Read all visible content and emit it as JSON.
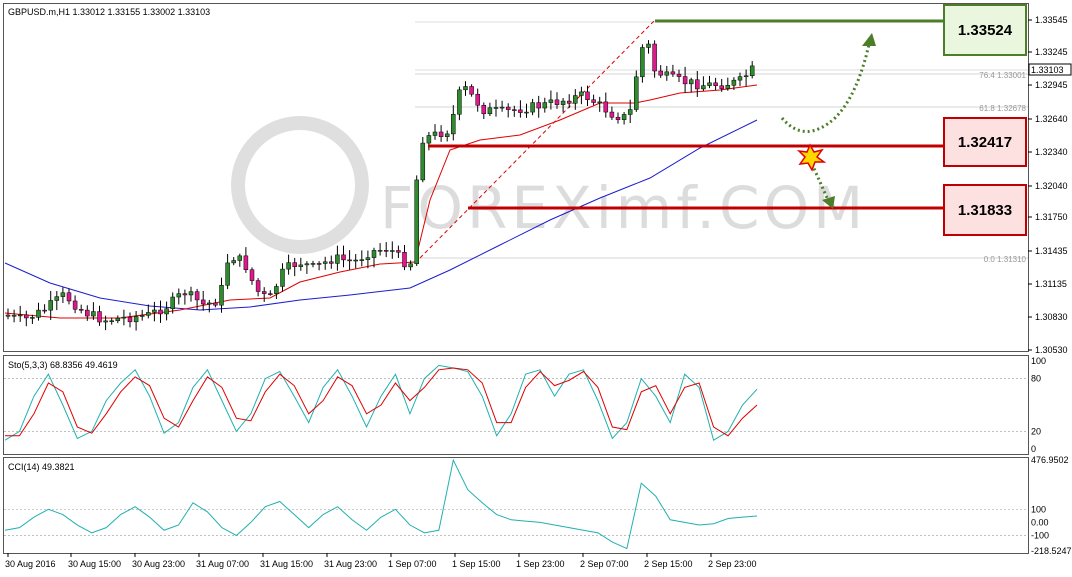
{
  "main_panel": {
    "title": "GBPUSD.m,H1  1.33012 1.33155 1.33002 1.33103",
    "current_price": "1.33103",
    "price_ticks": [
      "1.33545",
      "1.33245",
      "1.32945",
      "1.32640",
      "1.32340",
      "1.32040",
      "1.31750",
      "1.31435",
      "1.31135",
      "1.30830",
      "1.30530"
    ],
    "fib_levels": [
      {
        "label": "76.4  1.33001"
      },
      {
        "label": "61.8  1.32678"
      },
      {
        "label": "0.0  1.31310"
      }
    ]
  },
  "levels": [
    {
      "name": "resistance",
      "value": "1.33524",
      "color": "#4e7d2a",
      "fill": "#eaf6dd"
    },
    {
      "name": "support-1",
      "value": "1.32417",
      "color": "#c00000",
      "fill": "#fde0e0"
    },
    {
      "name": "support-2",
      "value": "1.31833",
      "color": "#c00000",
      "fill": "#fde0e0"
    }
  ],
  "watermark": "FOREXimf.COM",
  "stochastic": {
    "title": "Sto(5,3,3) 68.8356 49.4619",
    "ticks": [
      "100",
      "80",
      "20",
      "0"
    ]
  },
  "cci": {
    "title": "CCI(14) 49.3821",
    "ticks": [
      "476.9502",
      "100",
      "0.00",
      "-100",
      "-218.5247"
    ]
  },
  "time_labels": [
    "30 Aug 2016",
    "30 Aug 15:00",
    "30 Aug 23:00",
    "31 Aug 07:00",
    "31 Aug 15:00",
    "31 Aug 23:00",
    "1 Sep 07:00",
    "1 Sep 15:00",
    "1 Sep 23:00",
    "2 Sep 07:00",
    "2 Sep 15:00",
    "2 Sep 23:00"
  ],
  "colors": {
    "bull": "#2e8b2e",
    "bear": "#e0188c",
    "ma_fast": "#e00000",
    "ma_slow": "#1c1cd0",
    "sto_main": "#20b0b0",
    "sto_signal": "#e00000",
    "cci": "#20b0b0",
    "arrow": "#4e7d2a"
  }
}
